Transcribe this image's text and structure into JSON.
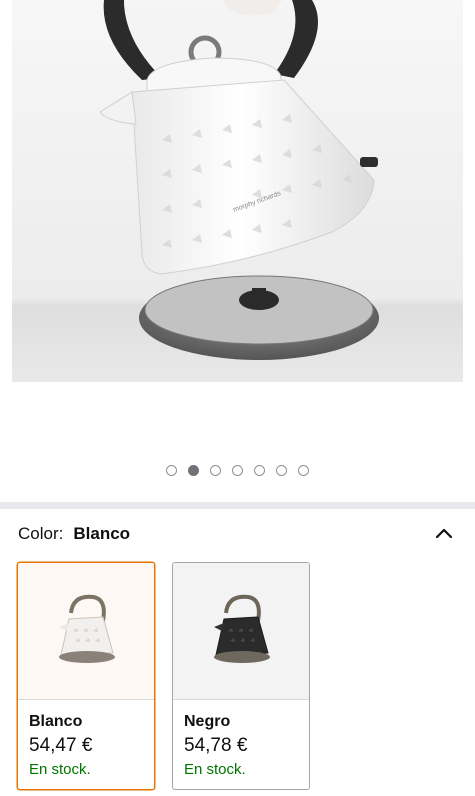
{
  "product_image": {
    "brand_text": "morphy richards",
    "alt": "kettle-photo"
  },
  "carousel": {
    "count": 7,
    "active_index": 1
  },
  "color_selector": {
    "label": "Color:",
    "selected_value": "Blanco",
    "expanded": true
  },
  "variants": [
    {
      "name": "Blanco",
      "price": "54,47 €",
      "stock": "En stock.",
      "selected": true
    },
    {
      "name": "Negro",
      "price": "54,78 €",
      "stock": "En stock.",
      "selected": false
    }
  ],
  "colors": {
    "accent_border": "#e77600",
    "in_stock_green": "#007600"
  }
}
